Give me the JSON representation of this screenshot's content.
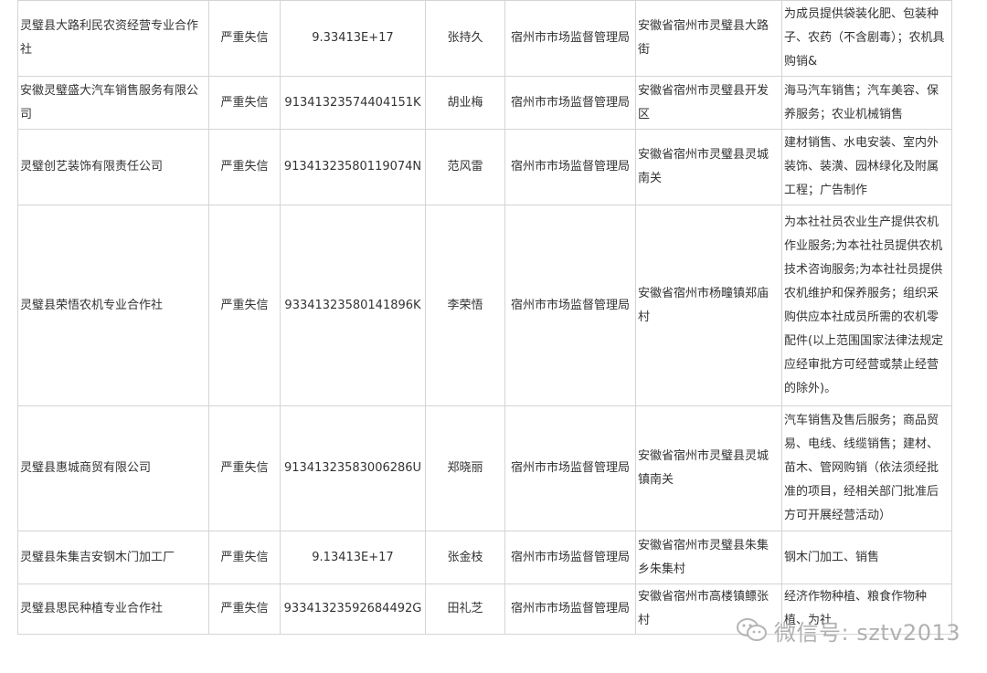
{
  "table": {
    "rows": [
      {
        "company": "灵璧县大路利民农资经营专业合作社",
        "status": "严重失信",
        "code": "9.33413E+17",
        "person": "张持久",
        "authority": "宿州市市场监督管理局",
        "address": "安徽省宿州市灵璧县大路街",
        "scope": "为成员提供袋装化肥、包装种子、农药（不含剧毒）；农机具购销&"
      },
      {
        "company": "安徽灵璧盛大汽车销售服务有限公司",
        "status": "严重失信",
        "code": "91341323574404151K",
        "person": "胡业梅",
        "authority": "宿州市市场监督管理局",
        "address": "安徽省宿州市灵璧县开发区",
        "scope": "海马汽车销售；汽车美容、保养服务；农业机械销售"
      },
      {
        "company": "灵璧创艺装饰有限责任公司",
        "status": "严重失信",
        "code": "91341323580119074N",
        "person": "范风雷",
        "authority": "宿州市市场监督管理局",
        "address": "安徽省宿州市灵璧县灵城南关",
        "scope": "建材销售、水电安装、室内外装饰、装潢、园林绿化及附属工程；广告制作"
      },
      {
        "company": "灵璧县荣悟农机专业合作社",
        "status": "严重失信",
        "code": "93341323580141896K",
        "person": "李荣悟",
        "authority": "宿州市市场监督管理局",
        "address": "安徽省宿州市杨疃镇郑庙村",
        "scope": "为本社社员农业生产提供农机作业服务;为本社社员提供农机技术咨询服务;为本社社员提供农机维护和保养服务；组织采购供应本社成员所需的农机零配件(以上范围国家法律法规定应经审批方可经营或禁止经营的除外)。"
      },
      {
        "company": "灵璧县惠城商贸有限公司",
        "status": "严重失信",
        "code": "91341323583006286U",
        "person": "郑晓丽",
        "authority": "宿州市市场监督管理局",
        "address": "安徽省宿州市灵璧县灵城镇南关",
        "scope": "汽车销售及售后服务；商品贸易、电线、线缆销售；建材、苗木、管网购销（依法须经批准的项目，经相关部门批准后方可开展经营活动）"
      },
      {
        "company": "灵璧县朱集吉安钢木门加工厂",
        "status": "严重失信",
        "code": "9.13413E+17",
        "person": "张金枝",
        "authority": "宿州市市场监督管理局",
        "address": "安徽省宿州市灵璧县朱集乡朱集村",
        "scope": "钢木门加工、销售"
      },
      {
        "company": "灵璧县思民种植专业合作社",
        "status": "严重失信",
        "code": "93341323592684492G",
        "person": "田礼芝",
        "authority": "宿州市市场监督管理局",
        "address": "安徽省宿州市高楼镇鳔张村",
        "scope": "经济作物种植、粮食作物种植、为社"
      }
    ]
  },
  "watermark": {
    "icon": "wechat-icon",
    "text": "微信号: sztv2013"
  }
}
